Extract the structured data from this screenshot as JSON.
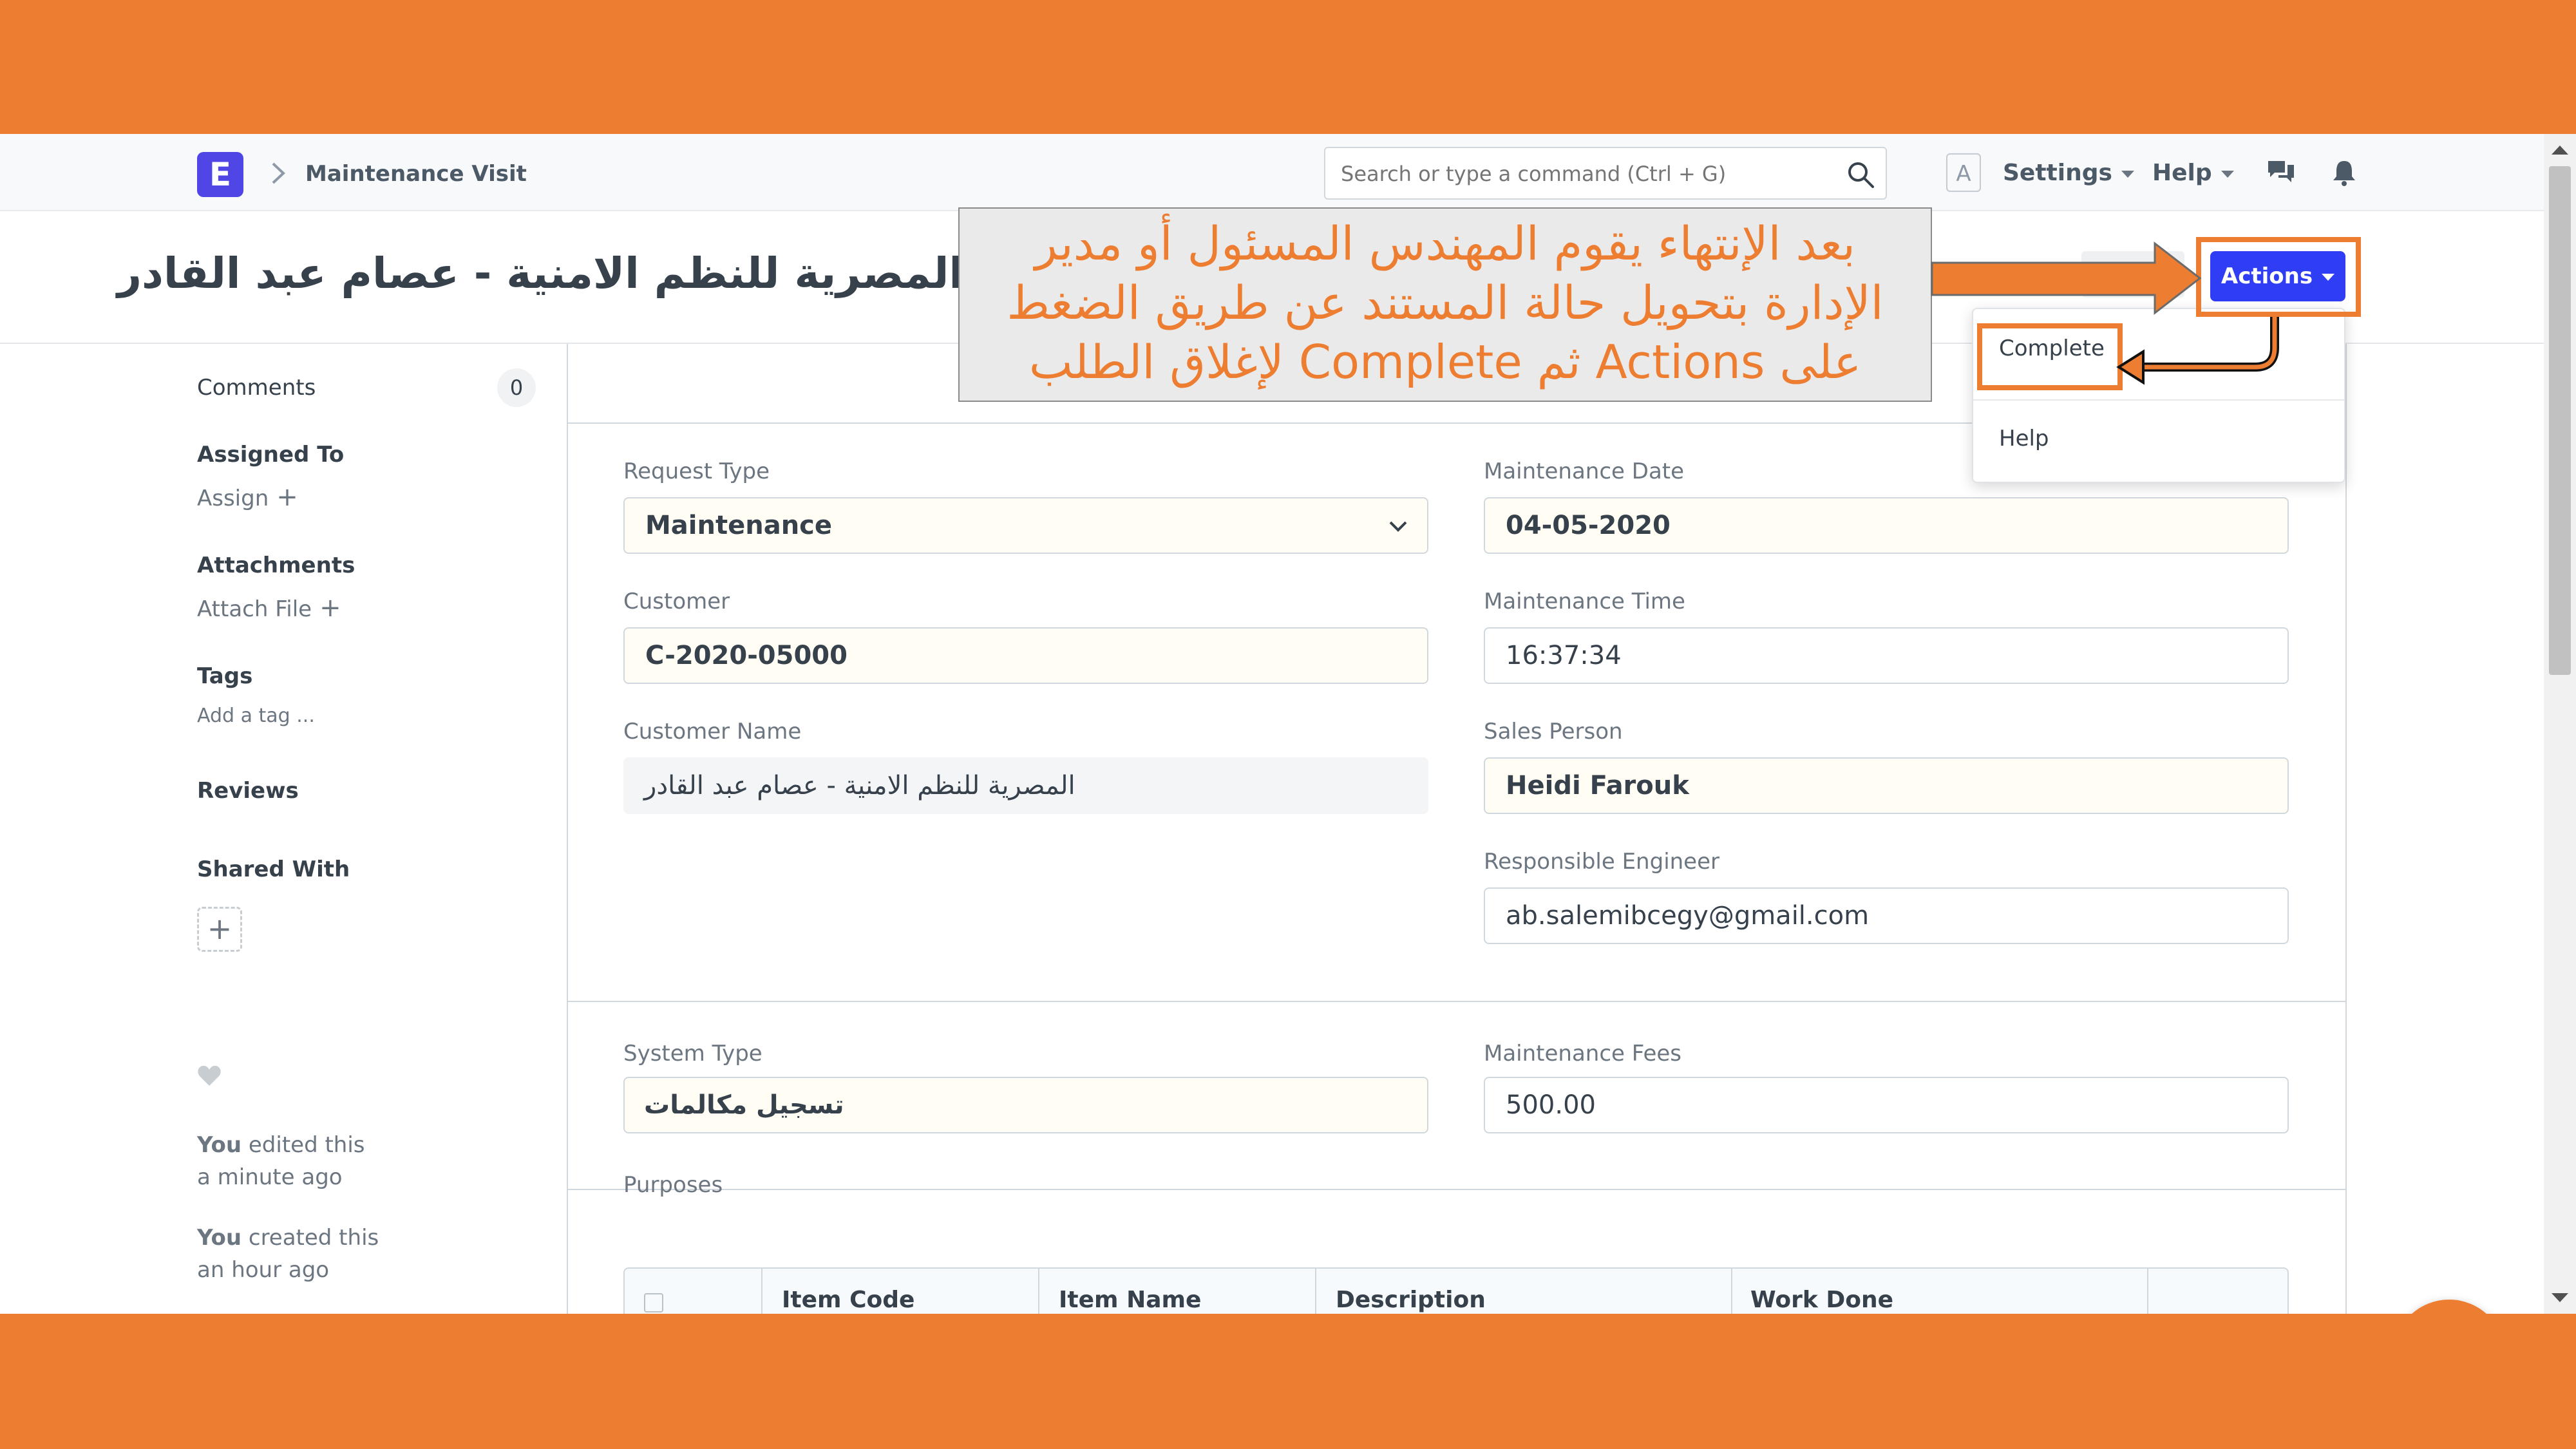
{
  "navbar": {
    "logo_letter": "E",
    "breadcrumb": "Maintenance Visit",
    "search_placeholder": "Search or type a command (Ctrl + G)",
    "avatar_letter": "A",
    "settings_label": "Settings",
    "help_label": "Help"
  },
  "page": {
    "title": "المصرية للنظم الامنية - عصام عبد القادر",
    "actions_label": "Actions",
    "actions_menu": [
      "Complete",
      "Help"
    ]
  },
  "sidebar": {
    "comments_label": "Comments",
    "comments_count": "0",
    "assigned_to_label": "Assigned To",
    "assign_label": "Assign",
    "attachments_label": "Attachments",
    "attach_file_label": "Attach File",
    "tags_label": "Tags",
    "add_tag_label": "Add a tag ...",
    "reviews_label": "Reviews",
    "shared_with_label": "Shared With",
    "activity": [
      {
        "who": "You",
        "action": " edited this",
        "when": "a minute ago"
      },
      {
        "who": "You",
        "action": " created this",
        "when": "an hour ago"
      }
    ]
  },
  "form": {
    "request_type": {
      "label": "Request Type",
      "value": "Maintenance"
    },
    "customer": {
      "label": "Customer",
      "value": "C-2020-05000"
    },
    "customer_name": {
      "label": "Customer Name",
      "value": "المصرية للنظم الامنية - عصام عبد القادر"
    },
    "maintenance_date": {
      "label": "Maintenance Date",
      "value": "04-05-2020"
    },
    "maintenance_time": {
      "label": "Maintenance Time",
      "value": "16:37:34"
    },
    "sales_person": {
      "label": "Sales Person",
      "value": "Heidi Farouk"
    },
    "responsible_engineer": {
      "label": "Responsible Engineer",
      "value": "ab.salemibcegy@gmail.com"
    },
    "system_type": {
      "label": "System Type",
      "value": "تسجيل مكالمات"
    },
    "maintenance_fees": {
      "label": "Maintenance Fees",
      "value": "500.00"
    },
    "purposes_label": "Purposes",
    "purposes_columns": [
      "Item Code",
      "Item Name",
      "Description",
      "Work Done"
    ]
  },
  "annotation": {
    "lines": [
      "بعد الإنتهاء يقوم المهندس المسئول أو مدير",
      "الإدارة بتحويل حالة المستند عن طريق الضغط",
      "على Actions ثم Complete لإغلاق الطلب"
    ]
  },
  "colors": {
    "slide_background": "#ED7D31",
    "actions_button": "#2F3EF5",
    "annotation_text": "#ED7D31"
  }
}
